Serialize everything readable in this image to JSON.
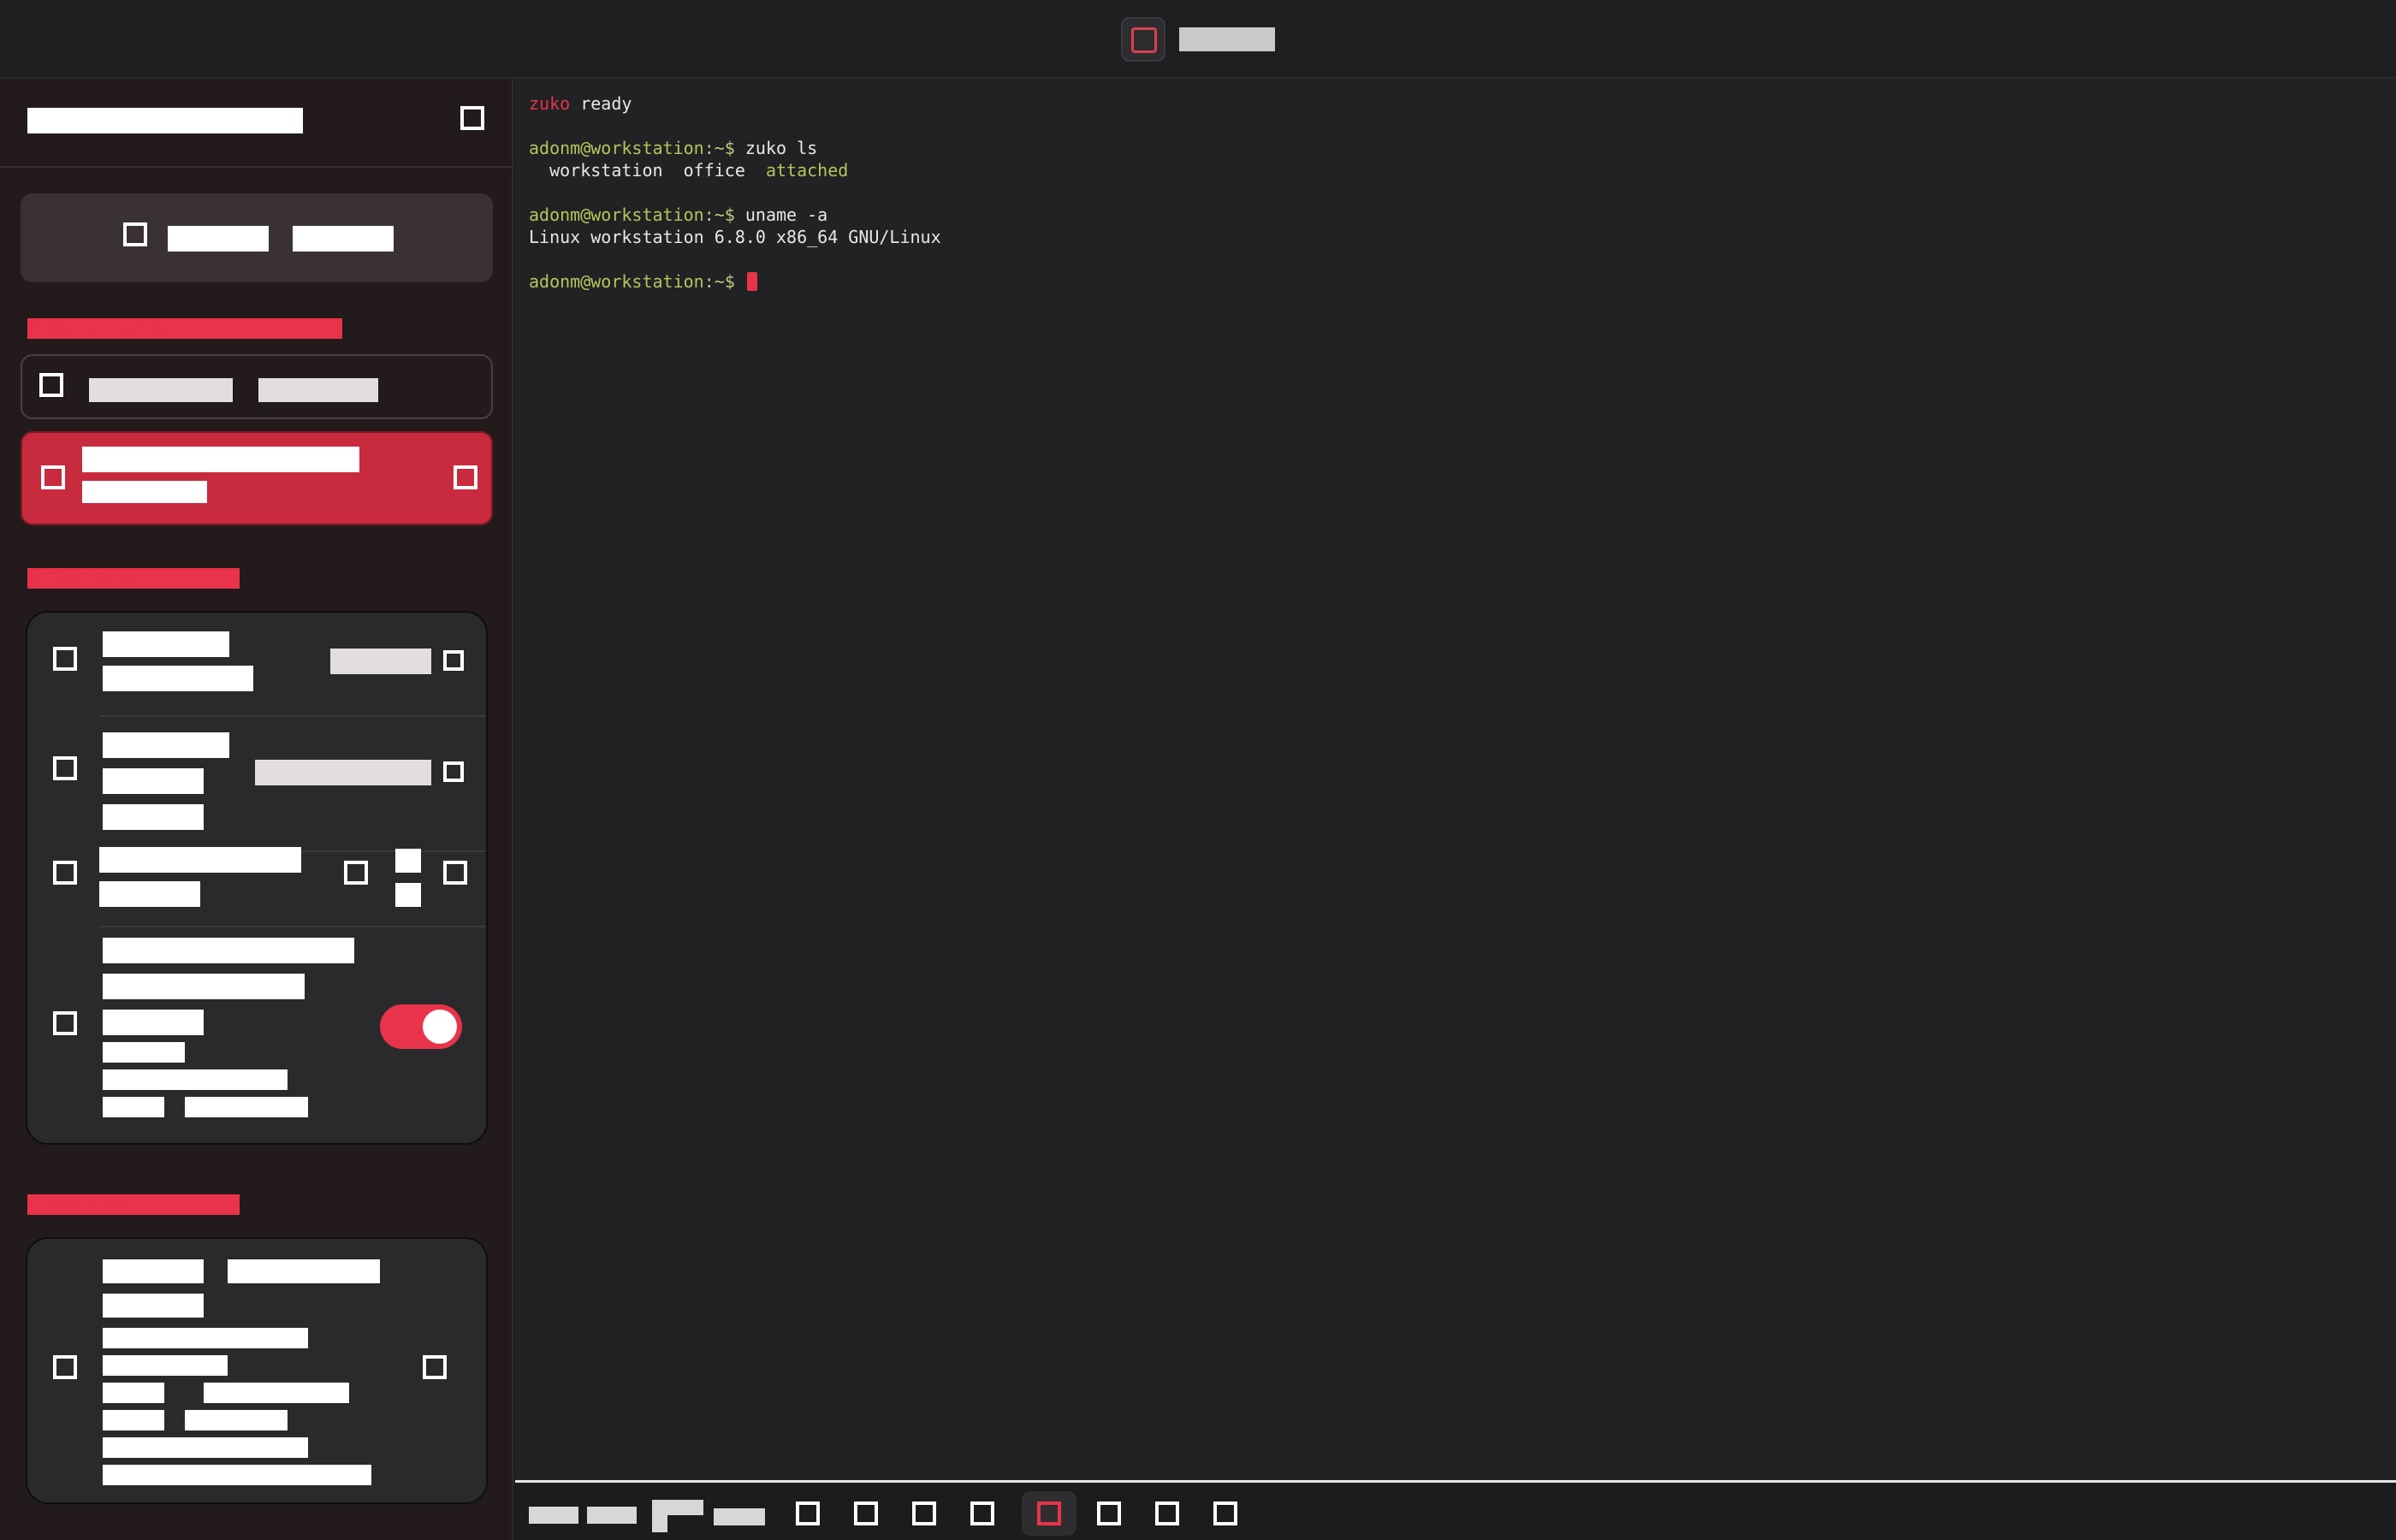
{
  "app": {
    "title": "zuko"
  },
  "sidebar": {
    "title": "workstation office",
    "new_session_label": "New session",
    "sessions_heading": "Active sessions",
    "sessions": [
      {
        "name": "workstation",
        "detail": "office"
      },
      {
        "name": "adonm@workstation",
        "detail": "attached"
      }
    ],
    "settings_heading": "Preferences",
    "settings": [
      {
        "title": "Terminal",
        "subtitle": "font size",
        "value": "14 px"
      },
      {
        "title": "Theme",
        "subtitle": "color",
        "value": "dark red"
      },
      {
        "title": "Scrollback",
        "subtitle": "lines"
      },
      {
        "title": "Reconnect automatically",
        "subtitle": "on network loss",
        "enabled": true
      }
    ],
    "connection_heading": "Connection"
  },
  "terminal": {
    "lines": [
      {
        "parts": [
          {
            "text": "zuko",
            "color": "red"
          },
          {
            "text": " ready",
            "color": "white"
          }
        ]
      },
      {
        "parts": [
          {
            "text": "adonm@workstation",
            "color": "green"
          },
          {
            "text": ":~$",
            "color": "yellow"
          },
          {
            "text": " zuko ls",
            "color": "white"
          }
        ]
      },
      {
        "parts": [
          {
            "text": "  workstation  office  ",
            "color": "white"
          },
          {
            "text": "attached",
            "color": "green"
          }
        ]
      },
      {
        "parts": [
          {
            "text": "adonm@workstation",
            "color": "green"
          },
          {
            "text": ":~$",
            "color": "yellow"
          },
          {
            "text": " uname -a",
            "color": "white"
          }
        ]
      },
      {
        "parts": [
          {
            "text": "Linux workstation 6.8.0 x86_64 GNU/Linux",
            "color": "white"
          }
        ]
      },
      {
        "parts": [
          {
            "text": "adonm@workstation",
            "color": "green"
          },
          {
            "text": ":~$",
            "color": "yellow"
          },
          {
            "text": " ",
            "color": "white"
          }
        ]
      }
    ]
  },
  "tabbar": {
    "labels": [
      "Esc",
      "Tab",
      "Ctrl",
      "Alt"
    ],
    "active_index": 4,
    "tab_count": 8
  },
  "colors": {
    "accent": "#e8334a",
    "prompt_green": "#b8c45a",
    "terminal_bg": "#202224",
    "sidebar_bg": "#231b1b"
  }
}
